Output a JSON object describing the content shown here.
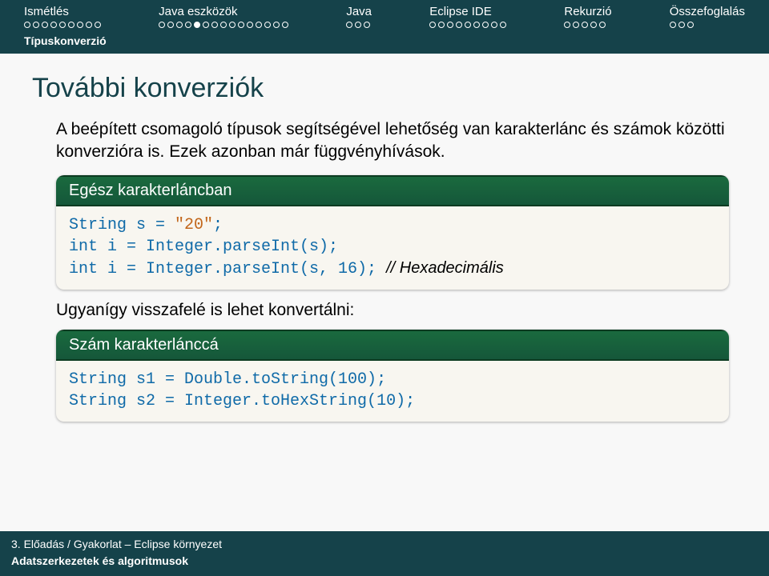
{
  "nav": {
    "items": [
      {
        "label": "Ismétlés",
        "total": 9,
        "current": -1
      },
      {
        "label": "Java eszközök",
        "total": 15,
        "current": 4
      },
      {
        "label": "Java",
        "total": 3,
        "current": -1
      },
      {
        "label": "Eclipse IDE",
        "total": 9,
        "current": -1
      },
      {
        "label": "Rekurzió",
        "total": 5,
        "current": -1
      },
      {
        "label": "Összefoglalás",
        "total": 3,
        "current": -1
      }
    ],
    "sub": "Típuskonverzió"
  },
  "title": "További konverziók",
  "intro": "A beépített csomagoló típusok segítségével lehetőség van karakterlánc és számok közötti konverzióra is. Ezek azonban már függvényhívások.",
  "block1": {
    "header": "Egész karakterláncban",
    "lines": {
      "l1a": "String s = ",
      "l1b": "\"20\"",
      "l1c": ";",
      "l2": "int i = Integer.parseInt(s);",
      "l3a": "int i = Integer.parseInt(s, 16); ",
      "l3b": "// Hexadecimális"
    }
  },
  "mid": "Ugyanígy visszafelé is lehet konvertálni:",
  "block2": {
    "header": "Szám karakterlánccá",
    "lines": {
      "l1": "String s1 = Double.toString(100);",
      "l2": "String s2 = Integer.toHexString(10);"
    }
  },
  "footer": {
    "line1": "3. Előadás / Gyakorlat – Eclipse környezet",
    "line2": "Adatszerkezetek és algoritmusok"
  }
}
